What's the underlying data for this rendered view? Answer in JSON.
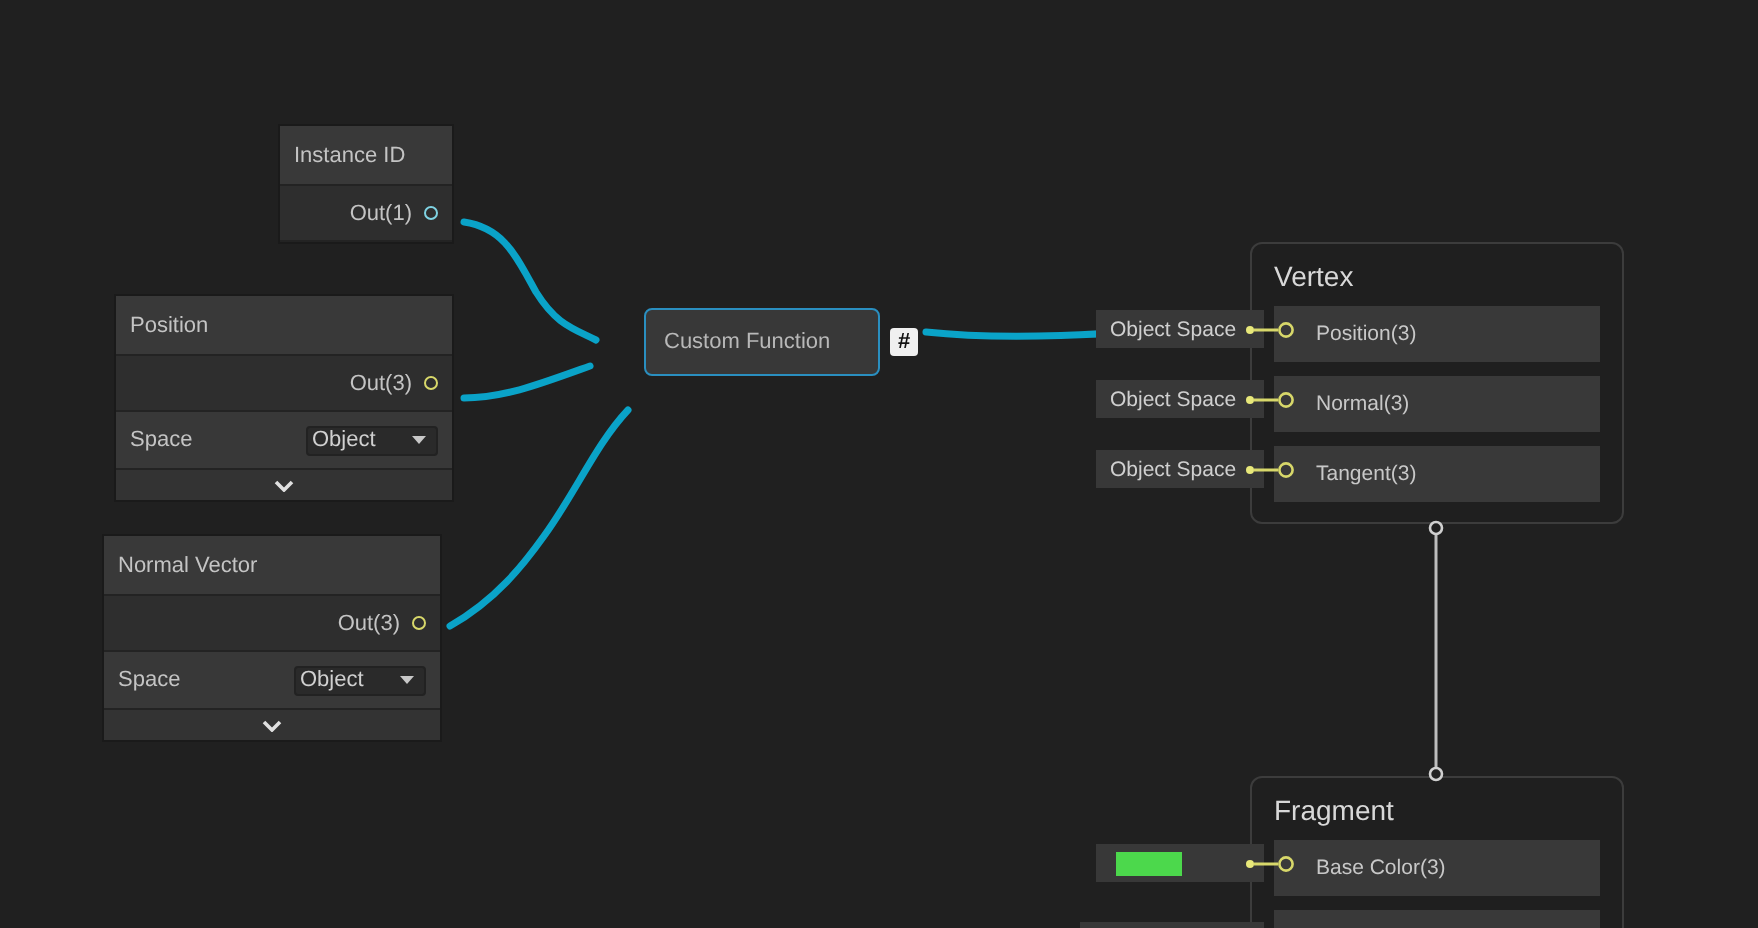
{
  "nodes": [
    {
      "kind": "property",
      "title": "Instance ID",
      "output": {
        "label": "Out(1)",
        "color": "#7fd3e3"
      }
    },
    {
      "kind": "property",
      "title": "Position",
      "output": {
        "label": "Out(3)",
        "color": "#d8d86a"
      },
      "space": {
        "label": "Space",
        "value": "Object"
      }
    },
    {
      "kind": "property",
      "title": "Normal Vector",
      "output": {
        "label": "Out(3)",
        "color": "#d8d86a"
      },
      "space": {
        "label": "Space",
        "value": "Object"
      }
    }
  ],
  "custom_function": {
    "title": "Custom Function",
    "badge": "#",
    "selected": true
  },
  "contexts": [
    {
      "title": "Vertex",
      "slots": [
        {
          "kind": "text",
          "input": "Object Space",
          "label": "Position(3)"
        },
        {
          "kind": "text",
          "input": "Object Space",
          "label": "Normal(3)"
        },
        {
          "kind": "text",
          "input": "Object Space",
          "label": "Tangent(3)"
        }
      ]
    },
    {
      "title": "Fragment",
      "slots": [
        {
          "kind": "color",
          "color": "#4cd84c",
          "label": "Base Color(3)"
        },
        {
          "kind": "cut"
        }
      ]
    }
  ]
}
